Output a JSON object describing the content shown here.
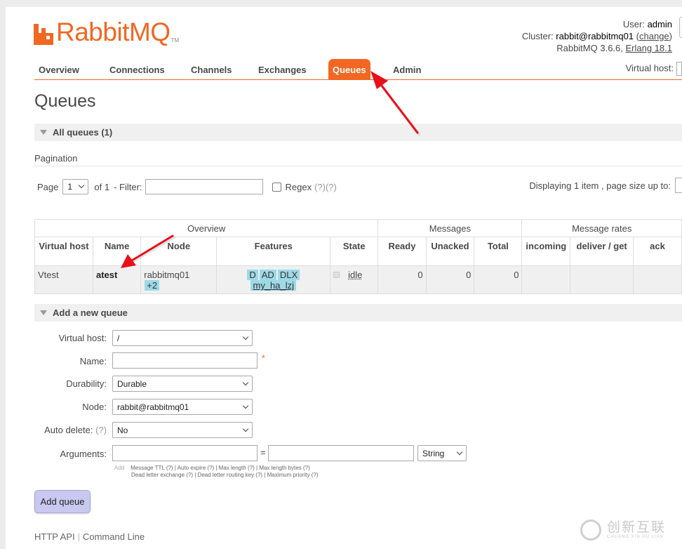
{
  "header": {
    "logo_text": "RabbitMQ",
    "logo_tm": "TM",
    "user_label": "User:",
    "user": "admin",
    "cluster_label": "Cluster:",
    "cluster": "rabbit@rabbitmq01",
    "change_link": "change",
    "version": "RabbitMQ 3.6.6,",
    "erlang": "Erlang 18.1"
  },
  "tabs": [
    {
      "label": "Overview"
    },
    {
      "label": "Connections"
    },
    {
      "label": "Channels"
    },
    {
      "label": "Exchanges"
    },
    {
      "label": "Queues"
    },
    {
      "label": "Admin"
    }
  ],
  "vhost_label": "Virtual host:",
  "page_title": "Queues",
  "all_queues": {
    "title": "All queues (1)",
    "pagination_label": "Pagination",
    "page_label": "Page",
    "page_value": "1",
    "of_label": "of 1",
    "filter_label": "- Filter:",
    "regex_label": "Regex",
    "regex_help": "(?)(?)",
    "displaying": "Displaying 1 item , page size up to:"
  },
  "table": {
    "groups": [
      "Overview",
      "Messages",
      "Message rates"
    ],
    "columns": [
      "Virtual host",
      "Name",
      "Node",
      "Features",
      "State",
      "Ready",
      "Unacked",
      "Total",
      "incoming",
      "deliver / get",
      "ack"
    ],
    "rows": [
      {
        "vhost": "Vtest",
        "name": "atest",
        "node": "rabbitmq01",
        "node_extra": "+2",
        "features": [
          "D",
          "AD",
          "DLX"
        ],
        "policy": "my_ha_lzj",
        "state": "idle",
        "ready": "0",
        "unacked": "0",
        "total": "0"
      }
    ]
  },
  "add_queue": {
    "title": "Add a new queue",
    "virtual_host_label": "Virtual host:",
    "virtual_host_value": "/",
    "name_label": "Name:",
    "name_required": "*",
    "durability_label": "Durability:",
    "durability_value": "Durable",
    "node_label": "Node:",
    "node_value": "rabbit@rabbitmq01",
    "auto_delete_label": "Auto delete:",
    "auto_delete_help": "(?)",
    "auto_delete_value": "No",
    "arguments_label": "Arguments:",
    "equals": "=",
    "arg_type": "String",
    "help_add": "Add",
    "help_line1": "Message TTL (?) | Auto expire (?) | Max length (?) | Max length bytes (?)",
    "help_line2": "Dead letter exchange (?) | Dead letter routing key (?) | Maximum priority (?)",
    "button": "Add queue"
  },
  "footer": {
    "http_api": "HTTP API",
    "command_line": "Command Line"
  },
  "watermark": {
    "text": "创新互联",
    "sub": "CHUANG XIN HU LIAN"
  },
  "colors": {
    "brand_orange": "#f26722",
    "arrow_red": "#e8101a",
    "tag_blue": "#9ed9e6",
    "button_purple": "#c8c8f0"
  }
}
